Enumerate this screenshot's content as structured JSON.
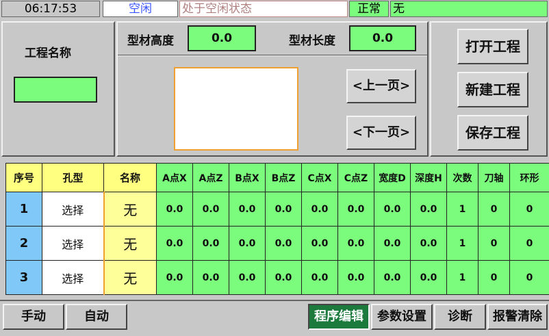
{
  "status": {
    "time": "06:17:53",
    "mode": "空闲",
    "message": "处于空闲状态",
    "state": "正常",
    "alarm": "无"
  },
  "project": {
    "name_label": "工程名称",
    "name_value": ""
  },
  "profile": {
    "height_label": "型材高度",
    "height_value": "0.0",
    "length_label": "型材长度",
    "length_value": "0.0",
    "prev_page": "<上一页>",
    "next_page": "<下一页>"
  },
  "actions": {
    "open": "打开工程",
    "new": "新建工程",
    "save": "保存工程"
  },
  "table": {
    "headers": [
      "序号",
      "孔型",
      "名称",
      "A点X",
      "A点Z",
      "B点X",
      "B点Z",
      "C点X",
      "C点Z",
      "宽度D",
      "深度H",
      "次数",
      "刀轴",
      "环形"
    ],
    "rows": [
      [
        "1",
        "选择",
        "无",
        "0.0",
        "0.0",
        "0.0",
        "0.0",
        "0.0",
        "0.0",
        "0.0",
        "0.0",
        "1",
        "0",
        "0"
      ],
      [
        "2",
        "选择",
        "无",
        "0.0",
        "0.0",
        "0.0",
        "0.0",
        "0.0",
        "0.0",
        "0.0",
        "0.0",
        "1",
        "0",
        "0"
      ],
      [
        "3",
        "选择",
        "无",
        "0.0",
        "0.0",
        "0.0",
        "0.0",
        "0.0",
        "0.0",
        "0.0",
        "0.0",
        "1",
        "0",
        "0"
      ]
    ]
  },
  "nav": {
    "manual": "手动",
    "auto": "自动",
    "program_edit": "程序编辑",
    "param_settings": "参数设置",
    "diagnostics": "诊断",
    "alarm_reset": "报警清除"
  },
  "colors": {
    "field_green": "#7cfc7c",
    "header_yellow": "#ffff80",
    "seq_blue": "#7fc8f8",
    "active_nav": "#1c7a3c"
  }
}
